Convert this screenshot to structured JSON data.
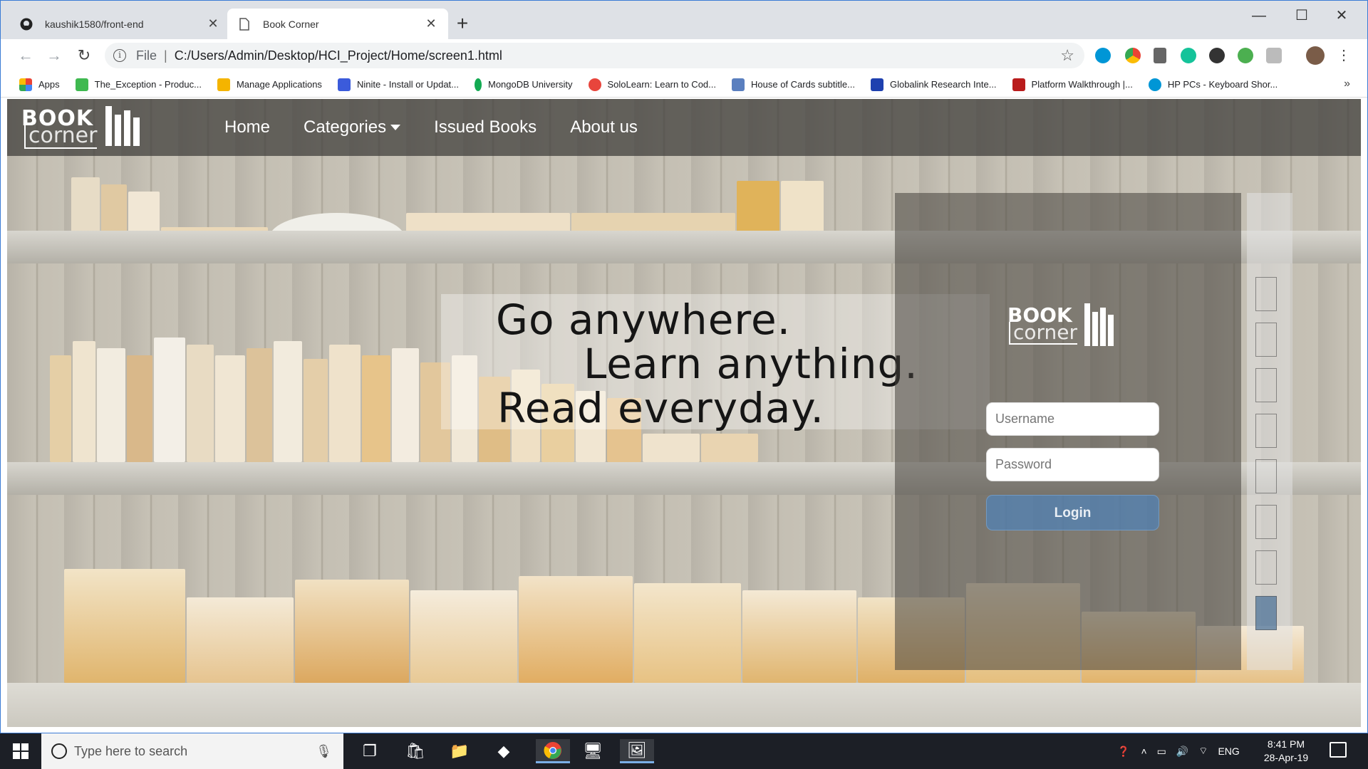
{
  "browser": {
    "tabs": [
      {
        "title": "kaushik1580/front-end",
        "active": false,
        "icon": "github-icon"
      },
      {
        "title": "Book Corner",
        "active": true,
        "icon": "page-icon"
      }
    ],
    "new_tab": "+",
    "window_controls": {
      "minimize": "—",
      "maximize": "☐",
      "close": "✕"
    },
    "address": {
      "scheme": "File",
      "separator": "|",
      "url": "C:/Users/Admin/Desktop/HCI_Project/Home/screen1.html"
    },
    "bookmarks": [
      {
        "label": "Apps",
        "color": "#e34133"
      },
      {
        "label": "The_Exception - Produc...",
        "color": "#3fb950"
      },
      {
        "label": "Manage Applications",
        "color": "#f4b400"
      },
      {
        "label": "Ninite - Install or Updat...",
        "color": "#3b5bdb"
      },
      {
        "label": "MongoDB University",
        "color": "#13aa52"
      },
      {
        "label": "SoloLearn: Learn to Cod...",
        "color": "#e8453c"
      },
      {
        "label": "House of Cards subtitle...",
        "color": "#5a7fbf"
      },
      {
        "label": "Globalink Research Inte...",
        "color": "#1e40af"
      },
      {
        "label": "Platform Walkthrough |...",
        "color": "#b91c1c"
      },
      {
        "label": "HP PCs - Keyboard Shor...",
        "color": "#0096d6"
      }
    ],
    "bookmarks_more": "»"
  },
  "site": {
    "logo": {
      "line1": "BOOK",
      "line2": "corner"
    },
    "nav": [
      {
        "label": "Home"
      },
      {
        "label": "Categories"
      },
      {
        "label": "Issued Books"
      },
      {
        "label": "About us"
      }
    ],
    "tagline": [
      "Go anywhere.",
      "Learn anything.",
      "Read everyday."
    ],
    "login": {
      "username_placeholder": "Username",
      "password_placeholder": "Password",
      "button": "Login"
    }
  },
  "taskbar": {
    "search_placeholder": "Type here to search",
    "language": "ENG",
    "time": "8:41 PM",
    "date": "28-Apr-19"
  },
  "colors": {
    "navbar_bg": "#3c3a37",
    "login_button": "#5282b4",
    "taskbar": "#1c1f26"
  }
}
